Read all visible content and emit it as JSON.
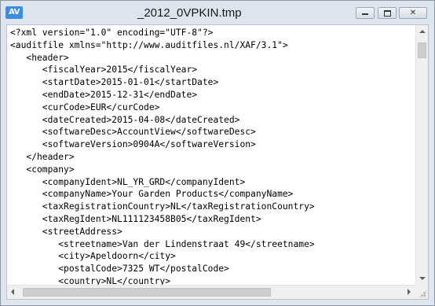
{
  "window": {
    "app_icon_text": "AV",
    "title": "_2012_0VPKIN.tmp",
    "controls": {
      "minimize": "minimize",
      "maximize": "maximize",
      "close": "close",
      "close_glyph": "✕"
    }
  },
  "icons": {
    "app": "av-app-icon",
    "minimize": "minimize-icon",
    "maximize": "maximize-icon",
    "close": "close-icon",
    "scroll_up": "arrow-up-icon",
    "scroll_down": "arrow-down-icon",
    "scroll_left": "arrow-left-icon",
    "scroll_right": "arrow-right-icon",
    "resize_grip": "resize-grip-icon"
  },
  "colors": {
    "app_icon_bg": "#3a8fe0",
    "title_bar": "#dce4ed",
    "editor_bg": "#ffffff",
    "text": "#000000"
  },
  "editor": {
    "lines": [
      "<?xml version=\"1.0\" encoding=\"UTF-8\"?>",
      "<auditfile xmlns=\"http://www.auditfiles.nl/XAF/3.1\">",
      "   <header>",
      "      <fiscalYear>2015</fiscalYear>",
      "      <startDate>2015-01-01</startDate>",
      "      <endDate>2015-12-31</endDate>",
      "      <curCode>EUR</curCode>",
      "      <dateCreated>2015-04-08</dateCreated>",
      "      <softwareDesc>AccountView</softwareDesc>",
      "      <softwareVersion>0904A</softwareVersion>",
      "   </header>",
      "   <company>",
      "      <companyIdent>NL_YR_GRD</companyIdent>",
      "      <companyName>Your Garden Products</companyName>",
      "      <taxRegistrationCountry>NL</taxRegistrationCountry>",
      "      <taxRegIdent>NL111123458B05</taxRegIdent>",
      "      <streetAddress>",
      "         <streetname>Van der Lindenstraat 49</streetname>",
      "         <city>Apeldoorn</city>",
      "         <postalCode>7325 WT</postalCode>",
      "         <country>NL</country>"
    ]
  }
}
